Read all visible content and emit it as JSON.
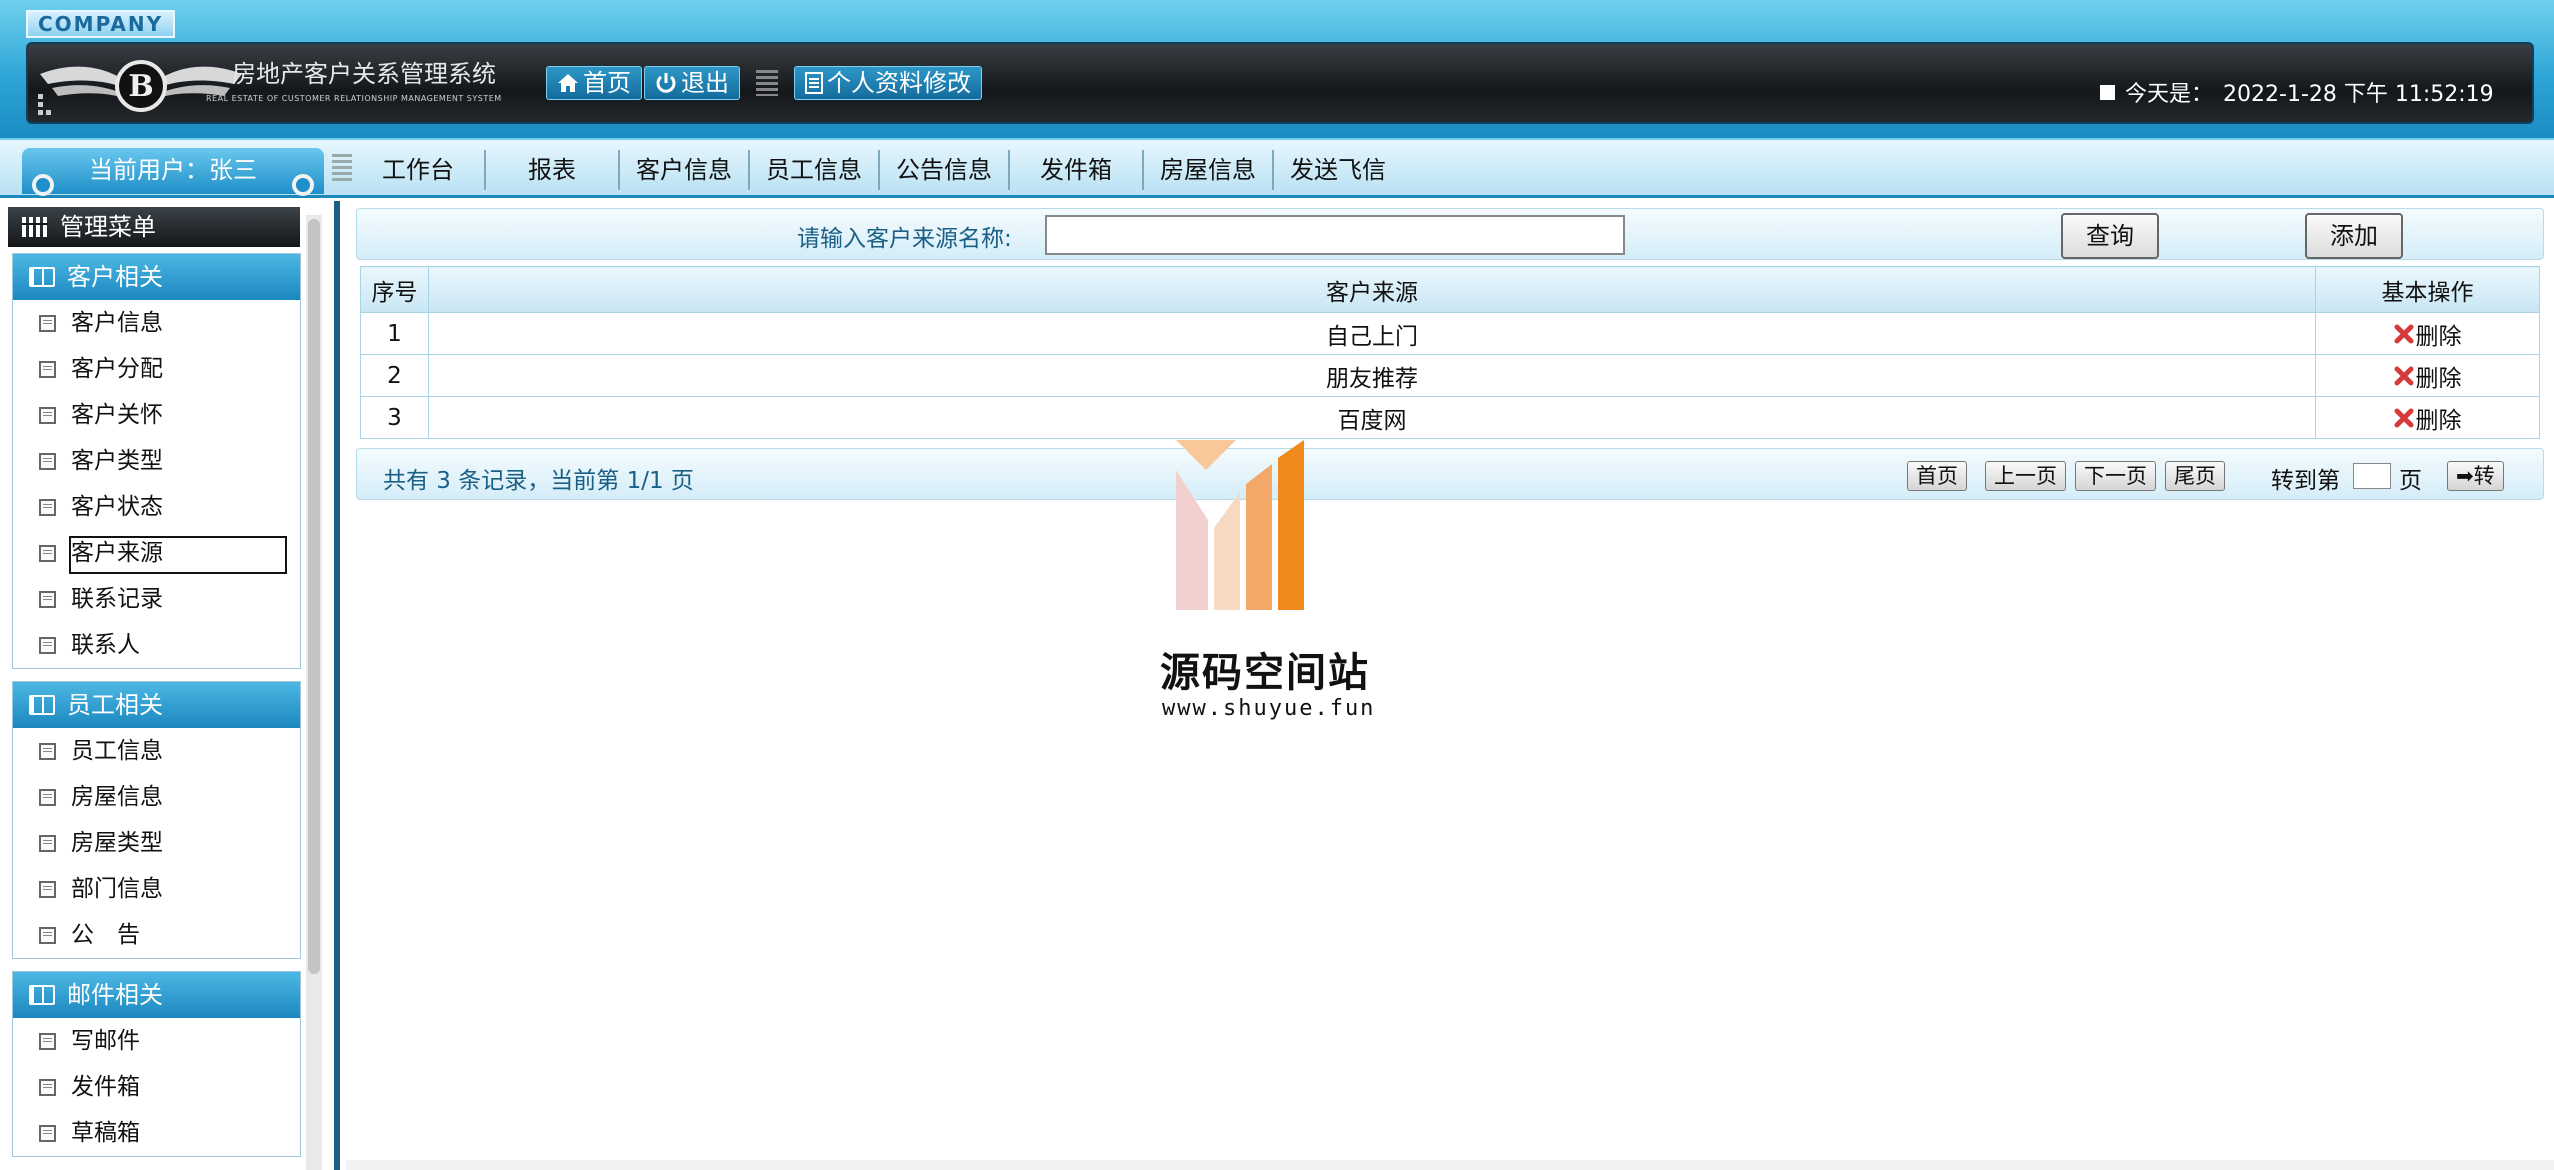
{
  "header": {
    "company": "COMPANY",
    "system_title": "房地产客户关系管理系统",
    "system_subtitle": "REAL ESTATE OF CUSTOMER RELATIONSHIP MANAGEMENT SYSTEM",
    "home_label": "首页",
    "logout_label": "退出",
    "profile_label": "个人资料修改",
    "today_label": "今天是：",
    "today_value": "2022-1-28 下午 11:52:19"
  },
  "nav": {
    "current_user": "当前用户：张三",
    "items": [
      "工作台",
      "报表",
      "客户信息",
      "员工信息",
      "公告信息",
      "发件箱",
      "房屋信息",
      "发送飞信"
    ]
  },
  "sidebar": {
    "title": "管理菜单",
    "groups": [
      {
        "title": "客户相关",
        "items": [
          "客户信息",
          "客户分配",
          "客户关怀",
          "客户类型",
          "客户状态",
          "客户来源",
          "联系记录",
          "联系人"
        ]
      },
      {
        "title": "员工相关",
        "items": [
          "员工信息",
          "房屋信息",
          "房屋类型",
          "部门信息",
          "公　告"
        ]
      },
      {
        "title": "邮件相关",
        "items": [
          "写邮件",
          "发件箱",
          "草稿箱"
        ]
      }
    ],
    "active_item": "客户来源"
  },
  "search": {
    "label": "请输入客户来源名称:",
    "value": "",
    "query_button": "查询",
    "add_button": "添加"
  },
  "table": {
    "headers": [
      "序号",
      "客户来源",
      "基本操作"
    ],
    "rows": [
      {
        "no": "1",
        "source": "自己上门",
        "action": "删除"
      },
      {
        "no": "2",
        "source": "朋友推荐",
        "action": "删除"
      },
      {
        "no": "3",
        "source": "百度网",
        "action": "删除"
      }
    ]
  },
  "pagination": {
    "info": "共有 3 条记录，当前第 1/1 页",
    "first": "首页",
    "prev": "上一页",
    "next": "下一页",
    "last": "尾页",
    "goto_prefix": "转到第",
    "goto_suffix": "页",
    "go_button": "➡转"
  },
  "watermark": {
    "title": "源码空间站",
    "url": "www.shuyue.fun"
  },
  "colors": {
    "header_blue": "#2ea6d6",
    "dark_bar": "#14171a",
    "group_blue": "#1b87bf",
    "delete_red": "#d63a3a",
    "text_blue": "#1a5f86"
  }
}
